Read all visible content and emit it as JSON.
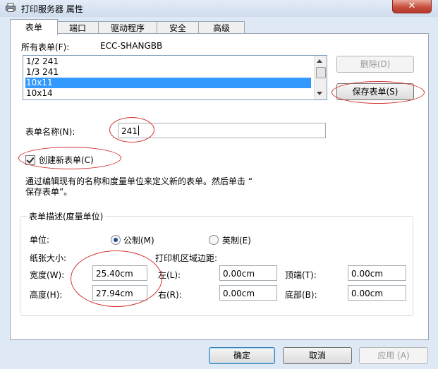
{
  "window": {
    "title": "打印服务器 属性",
    "close_glyph": "✕"
  },
  "tabs": [
    "表单",
    "端口",
    "驱动程序",
    "安全",
    "高级"
  ],
  "forms": {
    "all_forms_label": "所有表单(F):",
    "server_name": "ECC-SHANGBB",
    "items": [
      "1/2 241",
      "1/3 241",
      "10x11",
      "10x14"
    ],
    "selected_index": 2,
    "delete_label": "删除(D)",
    "save_label": "保存表单(S)",
    "form_name_label": "表单名称(N):",
    "form_name_value": "241",
    "create_new_label": "创建新表单(C)",
    "create_new_checked": true,
    "description_line1": "通过编辑现有的名称和度量单位来定义新的表单。然后单击 “",
    "description_line2": "保存表单”。"
  },
  "measurements": {
    "group_title": "表单描述(度量单位)",
    "unit_label": "单位:",
    "metric_label": "公制(M)",
    "imperial_label": "英制(E)",
    "unit_selected": "metric",
    "paper_size_label": "纸张大小:",
    "margins_label": "打印机区域边距:",
    "width_label": "宽度(W):",
    "width_value": "25.40cm",
    "height_label": "高度(H):",
    "height_value": "27.94cm",
    "left_label": "左(L):",
    "left_value": "0.00cm",
    "right_label": "右(R):",
    "right_value": "0.00cm",
    "top_label": "顶端(T):",
    "top_value": "0.00cm",
    "bottom_label": "底部(B):",
    "bottom_value": "0.00cm"
  },
  "footer": {
    "ok_label": "确定",
    "cancel_label": "取消",
    "apply_label": "应用 (A)"
  },
  "colors": {
    "selection": "#3399ff",
    "annotation": "#d33030"
  }
}
